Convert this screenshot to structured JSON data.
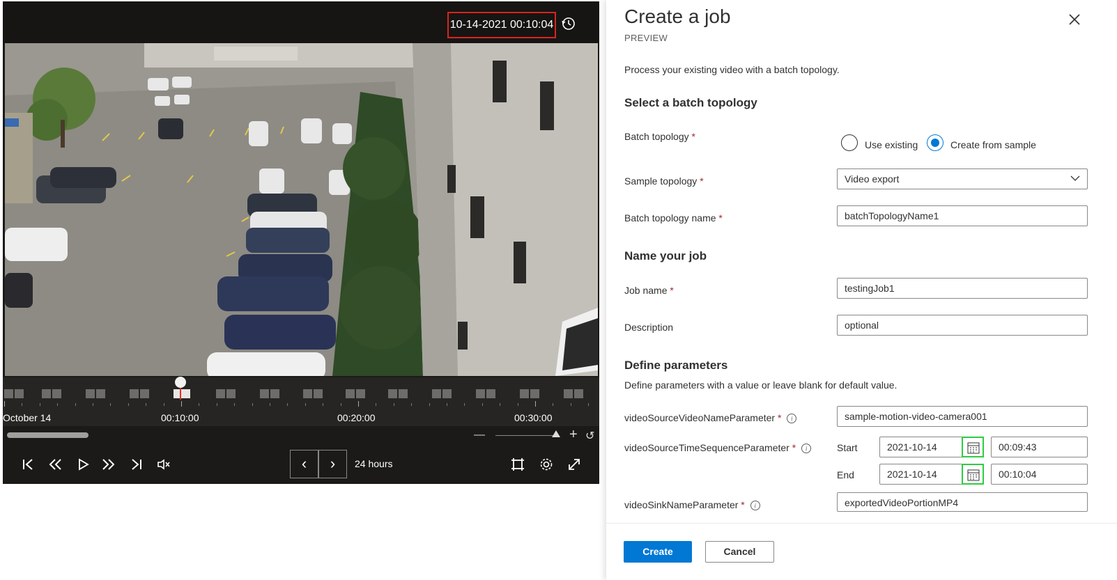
{
  "player": {
    "timestamp": "10-14-2021 00:10:04",
    "timeline_labels": [
      "October 14",
      "00:10:00",
      "00:20:00",
      "00:30:00"
    ],
    "range_label": "24 hours",
    "icons": {
      "history": "history-icon",
      "first": "skip-to-start-icon",
      "rewind": "rewind-icon",
      "play": "play-icon",
      "forward": "fast-forward-icon",
      "last": "skip-to-end-icon",
      "mute": "mute-icon",
      "prev": "chevron-left-icon",
      "next": "chevron-right-icon",
      "crop": "crop-icon",
      "settings": "gear-icon",
      "fullscreen": "expand-icon"
    }
  },
  "panel": {
    "title": "Create a job",
    "subtitle": "PREVIEW",
    "description": "Process your existing video with a batch topology.",
    "section_topology": "Select a batch topology",
    "section_job": "Name your job",
    "section_params": "Define parameters",
    "params_hint": "Define parameters with a value or leave blank for default value.",
    "fields": {
      "batch_topology_label": "Batch topology",
      "radio_existing": "Use existing",
      "radio_sample": "Create from sample",
      "radio_selected": "Create from sample",
      "sample_topology_label": "Sample topology",
      "sample_topology_value": "Video export",
      "topology_name_label": "Batch topology name",
      "topology_name_value": "batchTopologyName1",
      "job_name_label": "Job name",
      "job_name_value": "testingJob1",
      "description_label": "Description",
      "description_placeholder": "optional",
      "video_source_name_label": "videoSourceVideoNameParameter",
      "video_source_name_value": "sample-motion-video-camera001",
      "time_sequence_label": "videoSourceTimeSequenceParameter",
      "start_label": "Start",
      "start_date": "2021-10-14",
      "start_time": "00:09:43",
      "end_label": "End",
      "end_date": "2021-10-14",
      "end_time": "00:10:04",
      "sink_name_label": "videoSinkNameParameter",
      "sink_name_value": "exportedVideoPortionMP4"
    },
    "required_mark": "*",
    "info_glyph": "i",
    "buttons": {
      "create": "Create",
      "cancel": "Cancel"
    },
    "colors": {
      "accent": "#0078d4",
      "required": "#a4262c",
      "highlight_red": "#d9251c",
      "highlight_green": "#2ecc40"
    }
  }
}
